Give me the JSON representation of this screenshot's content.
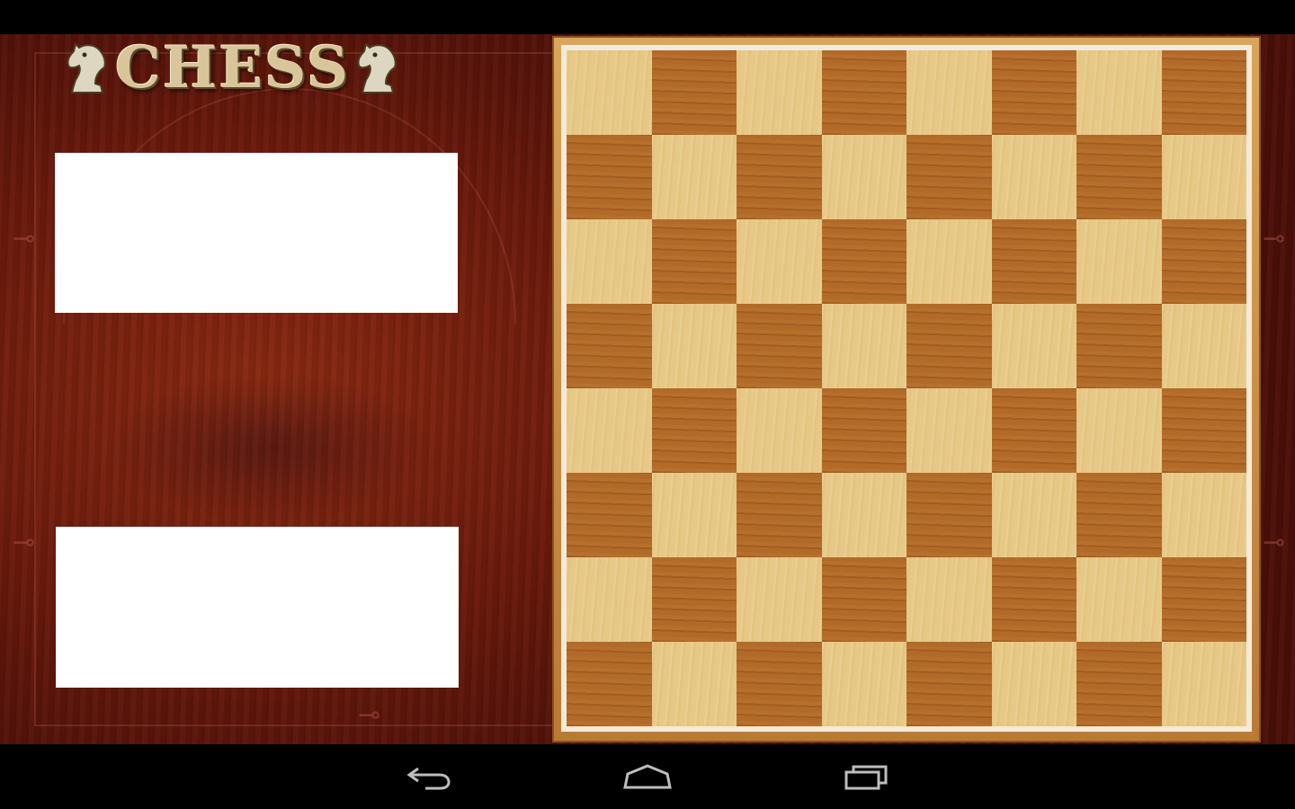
{
  "app": {
    "logo_text": "CHESS"
  },
  "board": {
    "files": 8,
    "ranks": 8,
    "light_color": "#e7c987",
    "dark_color": "#b26a28",
    "pieces": []
  },
  "player_panels": {
    "top": {
      "content": ""
    },
    "bottom": {
      "content": ""
    }
  },
  "nav_bar": {
    "buttons": [
      "back-icon",
      "home-icon",
      "recents-icon"
    ]
  },
  "colors": {
    "background_wood": "#6a1a0c",
    "board_frame": "#c98a42",
    "board_inner_border": "#f3ead7"
  }
}
